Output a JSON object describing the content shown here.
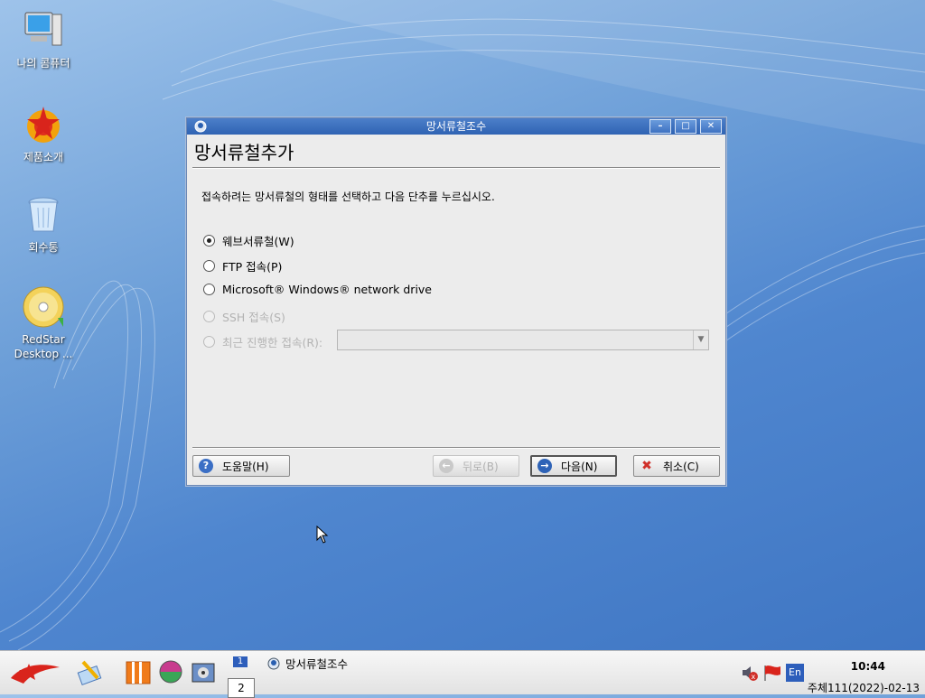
{
  "desktop": {
    "icons": [
      {
        "label": "나의 콤퓨터"
      },
      {
        "label": "제품소개"
      },
      {
        "label": "회수통"
      },
      {
        "label": "RedStar\nDesktop ..."
      }
    ]
  },
  "window": {
    "title": "망서류철조수",
    "heading": "망서류철추가",
    "instruction": "접속하려는 망서류철의 형태를 선택하고 다음 단추를 누르십시오.",
    "options": [
      {
        "label": "웨브서류철(W)",
        "checked": true,
        "disabled": false
      },
      {
        "label": "FTP 접속(P)",
        "checked": false,
        "disabled": false
      },
      {
        "label": "Microsoft® Windows® network drive",
        "checked": false,
        "disabled": false
      },
      {
        "label": "SSH 접속(S)",
        "checked": false,
        "disabled": true
      },
      {
        "label": "최근 진행한 접속(R):",
        "checked": false,
        "disabled": true
      }
    ],
    "recent_combo_value": "",
    "buttons": {
      "help": "도움말(H)",
      "back": "뒤로(B)",
      "next": "다음(N)",
      "cancel": "취소(C)"
    }
  },
  "taskbar": {
    "pager": {
      "page1": "1",
      "page2": "2"
    },
    "task_label": "망서류철조수",
    "language": "En",
    "clock": "10:44",
    "date": "주체111(2022)-02-13"
  },
  "colors": {
    "titlebar": "#2f63b3",
    "desktop": "#4f86cf",
    "help_icon": "#3b6fc5",
    "next_icon": "#2e63b7",
    "cancel_icon": "#d0302a"
  }
}
